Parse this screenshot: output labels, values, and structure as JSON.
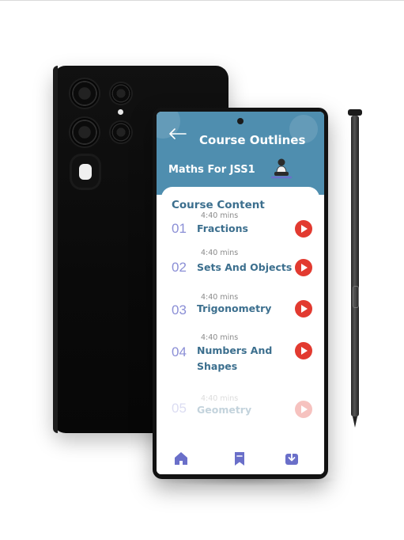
{
  "header": {
    "title": "Course Outlines",
    "course": "Maths For JSS1"
  },
  "section_title": "Course Content",
  "lessons": [
    {
      "number": "01",
      "duration": "4:40 mins",
      "title_line1": "Fractions",
      "title_line2": ""
    },
    {
      "number": "02",
      "duration": "4:40 mins",
      "title_line1": "Sets And Objects",
      "title_line2": ""
    },
    {
      "number": "03",
      "duration": "4:40 mins",
      "title_line1": "Trigonometry",
      "title_line2": ""
    },
    {
      "number": "04",
      "duration": "4:40 mins",
      "title_line1": "Numbers And",
      "title_line2": "Shapes"
    },
    {
      "number": "05",
      "duration": "4:40 mins",
      "title_line1": "Geometry",
      "title_line2": ""
    }
  ],
  "bottom_nav": [
    "home-icon",
    "bookmark-icon",
    "download-icon"
  ],
  "colors": {
    "header": "#4f8eaf",
    "accent_text": "#3c6f8e",
    "number": "#8b8fd6",
    "play": "#e23a30",
    "nav_icon": "#6a6fc9"
  }
}
